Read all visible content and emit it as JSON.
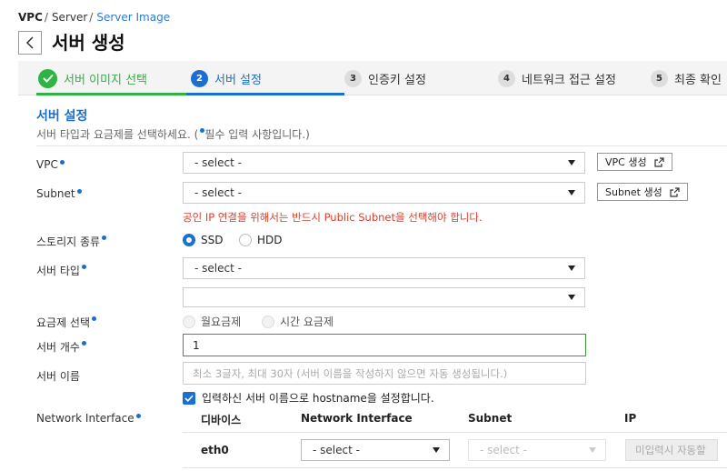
{
  "breadcrumb": {
    "items": [
      "VPC",
      "Server",
      "Server Image"
    ]
  },
  "page": {
    "title": "서버 생성"
  },
  "steps": [
    {
      "number": "",
      "label": "서버 이미지 선택",
      "state": "done"
    },
    {
      "number": "2",
      "label": "서버 설정",
      "state": "active"
    },
    {
      "number": "3",
      "label": "인증키 설정",
      "state": "todo"
    },
    {
      "number": "4",
      "label": "네트워크 접근 설정",
      "state": "todo"
    },
    {
      "number": "5",
      "label": "최종 확인",
      "state": "todo"
    }
  ],
  "section": {
    "title": "서버 설정",
    "desc_prefix": "서버 타입과 요금제를 선택하세요. (",
    "desc_suffix": "필수 입력 사항입니다.)"
  },
  "form": {
    "vpc": {
      "label": "VPC",
      "value": "- select -",
      "button": "VPC 생성"
    },
    "subnet": {
      "label": "Subnet",
      "value": "- select -",
      "button": "Subnet 생성",
      "warning": "공인 IP 연결을 위해서는 반드시 Public Subnet을 선택해야 합니다."
    },
    "storage": {
      "label": "스토리지 종류",
      "options": [
        "SSD",
        "HDD"
      ],
      "selected": "SSD"
    },
    "server_type": {
      "label": "서버 타입",
      "value": "- select -",
      "value2": ""
    },
    "plan": {
      "label": "요금제 선택",
      "options": [
        "월요금제",
        "시간 요금제"
      ]
    },
    "server_count": {
      "label": "서버 개수",
      "value": "1"
    },
    "server_name": {
      "label": "서버 이름",
      "placeholder": "최소 3글자, 최대 30자 (서버 이름을 작성하지 않으면 자동 생성됩니다.)"
    },
    "hostname_check": {
      "label": "입력하신 서버 이름으로 hostname을 설정합니다.",
      "checked": true
    },
    "network_interface": {
      "label": "Network Interface",
      "columns": [
        "디바이스",
        "Network Interface",
        "Subnet",
        "IP"
      ],
      "rows": [
        {
          "device": "eth0",
          "interface": "- select -",
          "subnet": "- select -",
          "ip": "미입력시 자동할"
        }
      ]
    }
  },
  "colors": {
    "accent": "#1a6fd0",
    "done": "#2fb344",
    "warning": "#d8402f"
  },
  "icons": {
    "back": "chevron-left-icon",
    "external": "external-link-icon",
    "done": "check-icon"
  }
}
